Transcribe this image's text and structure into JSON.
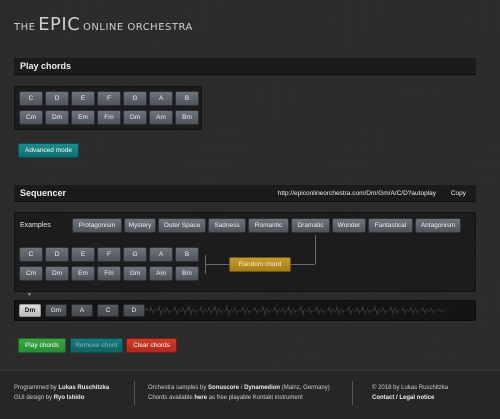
{
  "header": {
    "title_part1": "THE",
    "title_part2": "EPIC",
    "title_part3": "ONLINE ORCHESTRA"
  },
  "play_chords": {
    "title": "Play chords",
    "major_row": [
      "C",
      "D",
      "E",
      "F",
      "G",
      "A",
      "B"
    ],
    "minor_row": [
      "Cm",
      "Dm",
      "Em",
      "Fm",
      "Gm",
      "Am",
      "Bm"
    ],
    "advanced_mode_label": "Advanced mode"
  },
  "sequencer": {
    "title": "Sequencer",
    "url": "http://epiconlineorchestra.com/Dm/Gm/A/C/D?autoplay",
    "copy_label": "Copy",
    "examples_label": "Examples",
    "examples": [
      "Protagonism",
      "Mystery",
      "Outer Space",
      "Sadness",
      "Romantic",
      "Dramatic",
      "Wonder",
      "Fantastical",
      "Antagonism"
    ],
    "major_row": [
      "C",
      "D",
      "E",
      "F",
      "G",
      "A",
      "B"
    ],
    "minor_row": [
      "Cm",
      "Dm",
      "Em",
      "Fm",
      "Gm",
      "Am",
      "Bm"
    ],
    "random_chord_label": "Random chord",
    "caret": "▼",
    "timeline": [
      "Dm",
      "Gm",
      "A",
      "C",
      "D"
    ],
    "play_label": "Play chords",
    "remove_label": "Remove chord",
    "clear_label": "Clear chords"
  },
  "footer": {
    "col1_line1_prefix": "Programmed by ",
    "col1_line1_name": "Lukas Ruschitzka",
    "col1_line2_prefix": "GUI design by ",
    "col1_line2_name": "Ryo Ishido",
    "col2_line1_a": "Orchestra samples by ",
    "col2_line1_b": "Sonuscore",
    "col2_line1_c": " / ",
    "col2_line1_d": "Dynamedion",
    "col2_line1_e": " (Mainz, Germany)",
    "col2_line2_a": "Chords available ",
    "col2_line2_b": "here",
    "col2_line2_c": " as free playable Kontakt instrument",
    "col3_line1": "© 2018 by Lukas Ruschitzka",
    "col3_line2": "Contact / Legal notice"
  },
  "colors": {
    "background": "#2b2b2b",
    "section_bar": "#1b1b1b",
    "chord_button": "#5f656b",
    "teal_button": "#178082",
    "green_button": "#33a03e",
    "red_button": "#c23325",
    "gold_button": "#b8912a"
  }
}
